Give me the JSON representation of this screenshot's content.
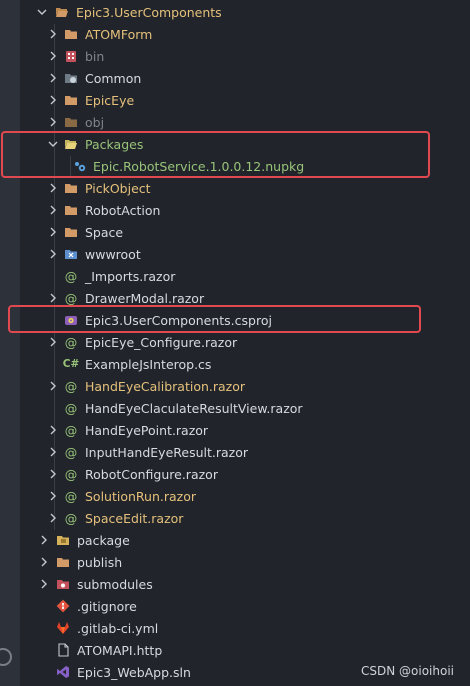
{
  "colors": {
    "background": "#21252b",
    "folder": "#d19a66",
    "highlight_box": "#e0494f",
    "razor_at": "#98c379",
    "text_default": "#d7dae0",
    "text_modified": "#e5c07b",
    "text_ignored": "#7f848e",
    "text_added": "#98c379"
  },
  "tree": {
    "root": {
      "label": "Epic3.UserComponents",
      "icon": "folder-open-icon",
      "expanded": true
    },
    "items": [
      {
        "label": "ATOMForm",
        "icon": "folder-icon",
        "chevron": "right"
      },
      {
        "label": "bin",
        "icon": "bin-folder-icon",
        "chevron": "right"
      },
      {
        "label": "Common",
        "icon": "common-folder-icon",
        "chevron": "right"
      },
      {
        "label": "EpicEye",
        "icon": "folder-icon",
        "chevron": "right"
      },
      {
        "label": "obj",
        "icon": "folder-icon",
        "chevron": "right"
      },
      {
        "label": "Packages",
        "icon": "folder-open-icon",
        "chevron": "down"
      },
      {
        "label": "Epic.RobotService.1.0.0.12.nupkg",
        "icon": "nuget-icon",
        "chevron": ""
      },
      {
        "label": "PickObject",
        "icon": "folder-icon",
        "chevron": "right"
      },
      {
        "label": "RobotAction",
        "icon": "folder-icon",
        "chevron": "right"
      },
      {
        "label": "Space",
        "icon": "folder-icon",
        "chevron": "right"
      },
      {
        "label": "wwwroot",
        "icon": "www-folder-icon",
        "chevron": "right"
      },
      {
        "label": "_Imports.razor",
        "icon": "razor-icon",
        "chevron": ""
      },
      {
        "label": "DrawerModal.razor",
        "icon": "razor-icon",
        "chevron": "right"
      },
      {
        "label": "Epic3.UserComponents.csproj",
        "icon": "csproj-icon",
        "chevron": ""
      },
      {
        "label": "EpicEye_Configure.razor",
        "icon": "razor-icon",
        "chevron": "right"
      },
      {
        "label": "ExampleJsInterop.cs",
        "icon": "csharp-icon",
        "chevron": ""
      },
      {
        "label": "HandEyeCalibration.razor",
        "icon": "razor-icon",
        "chevron": "right"
      },
      {
        "label": "HandEyeClaculateResultView.razor",
        "icon": "razor-icon",
        "chevron": ""
      },
      {
        "label": "HandEyePoint.razor",
        "icon": "razor-icon",
        "chevron": "right"
      },
      {
        "label": "InputHandEyeResult.razor",
        "icon": "razor-icon",
        "chevron": "right"
      },
      {
        "label": "RobotConfigure.razor",
        "icon": "razor-icon",
        "chevron": "right"
      },
      {
        "label": "SolutionRun.razor",
        "icon": "razor-icon",
        "chevron": "right"
      },
      {
        "label": "SpaceEdit.razor",
        "icon": "razor-icon",
        "chevron": "right"
      },
      {
        "label": "package",
        "icon": "package-folder-icon",
        "chevron": "right"
      },
      {
        "label": "publish",
        "icon": "folder-icon",
        "chevron": "right"
      },
      {
        "label": "submodules",
        "icon": "git-folder-icon",
        "chevron": "right"
      },
      {
        "label": ".gitignore",
        "icon": "git-icon",
        "chevron": ""
      },
      {
        "label": ".gitlab-ci.yml",
        "icon": "gitlab-icon",
        "chevron": ""
      },
      {
        "label": "ATOMAPI.http",
        "icon": "http-file-icon",
        "chevron": ""
      },
      {
        "label": "Epic3_WebApp.sln",
        "icon": "visual-studio-icon",
        "chevron": ""
      }
    ]
  },
  "watermark": "CSDN @oioihoii"
}
